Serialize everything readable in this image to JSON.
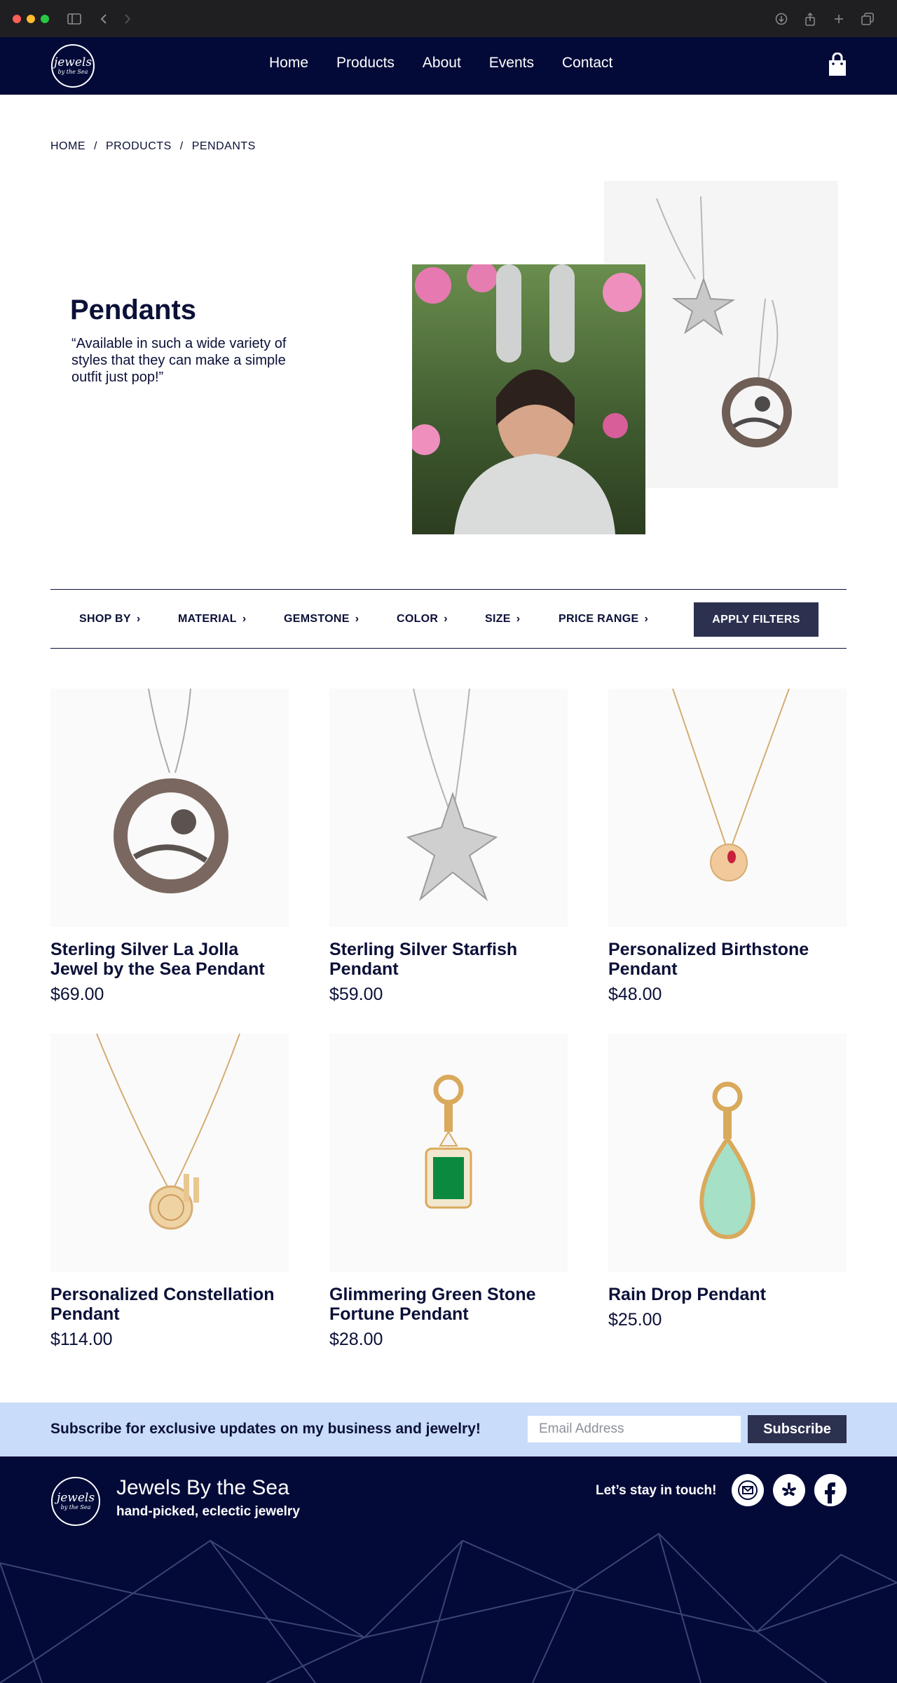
{
  "brand": {
    "logo_line1": "jewels",
    "logo_line2": "by the Sea",
    "name": "Jewels By the Sea",
    "tagline": "hand-picked, eclectic jewelry"
  },
  "nav": {
    "items": [
      "Home",
      "Products",
      "About",
      "Events",
      "Contact"
    ],
    "cart_icon": "shopping-bag-icon"
  },
  "breadcrumb": {
    "items": [
      "HOME",
      "PRODUCTS",
      "PENDANTS"
    ],
    "separator": "/"
  },
  "hero": {
    "title": "Pendants",
    "quote": "“Available in such a wide variety of styles that they can make a simple outfit just pop!”"
  },
  "filters": {
    "items": [
      "SHOP BY",
      "MATERIAL",
      "GEMSTONE",
      "COLOR",
      "SIZE",
      "PRICE RANGE"
    ],
    "apply_label": "APPLY FILTERS"
  },
  "products": [
    {
      "name": "Sterling Silver La Jolla Jewel by the Sea Pendant",
      "price": "$69.00"
    },
    {
      "name": "Sterling Silver Starfish Pendant",
      "price": "$59.00"
    },
    {
      "name": "Personalized Birthstone Pendant",
      "price": "$48.00"
    },
    {
      "name": "Personalized Constellation Pendant",
      "price": "$114.00"
    },
    {
      "name": "Glimmering Green Stone Fortune Pendant",
      "price": "$28.00"
    },
    {
      "name": "Rain Drop Pendant",
      "price": "$25.00"
    }
  ],
  "subscribe": {
    "text": "Subscribe for exclusive updates on my business and jewelry!",
    "placeholder": "Email Address",
    "button": "Subscribe"
  },
  "footer": {
    "touch": "Let’s stay in touch!",
    "social_icons": [
      "mail-icon",
      "yelp-icon",
      "facebook-icon"
    ]
  },
  "colors": {
    "navy": "#030a38",
    "button": "#2c3150",
    "subscribe_bg": "#c9dcfa"
  }
}
